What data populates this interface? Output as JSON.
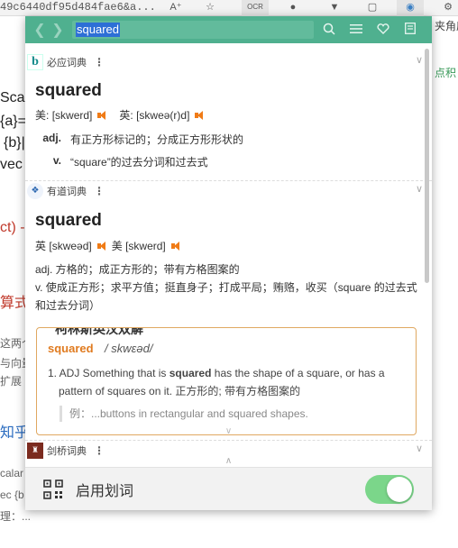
{
  "browser": {
    "url_fragment": "49c6440df95d484fae6&a...",
    "reader_icon": "A⁺",
    "extension_icons": [
      "bookmark-icon",
      "ocr-icon",
      "extension-icon",
      "extension-icon",
      "extension-icon",
      "extension-icon"
    ],
    "right_fragment_1": "夹角度",
    "right_fragment_2": "点积"
  },
  "background": {
    "lines": [
      "Scal",
      "{a}=",
      "{b}|",
      "vec",
      "ct) -",
      "算式",
      "这两个",
      "与向量",
      "扩展",
      "知乎",
      "calar",
      "ec {b",
      "理：..."
    ]
  },
  "popup": {
    "search_value": "squared",
    "accent": "#4fb08f",
    "header_buttons": [
      "search-icon",
      "menu-icon",
      "heart-icon",
      "bookmark-icon"
    ],
    "bing": {
      "name": "必应词典",
      "word": "squared",
      "phon_us_label": "美:",
      "phon_us": "[skwerd]",
      "phon_uk_label": "英:",
      "phon_uk": "[skweə(r)d]",
      "defs": [
        {
          "pos": "adj.",
          "text": "有正方形标记的；分成正方形形状的"
        },
        {
          "pos": "v.",
          "text": "“square”的过去分词和过去式"
        }
      ]
    },
    "youdao": {
      "name": "有道词典",
      "word": "squared",
      "phon_uk_label": "英",
      "phon_uk": "[skweəd]",
      "phon_us_label": "美",
      "phon_us": "[skwerd]",
      "def_adj": "adj. 方格的；成正方形的；带有方格图案的",
      "def_v": "v. 使成正方形；求平方值；挺直身子；打成平局；贿赂，收买（square 的过去式和过去分词）",
      "collins": {
        "title": "柯林斯英汉双解",
        "word": "squared",
        "phon": "/ skwεəd/",
        "def_prefix": "1. ADJ Something that is",
        "def_bold": "squared",
        "def_suffix": "has the shape of a square, or has a pattern of squares on it. 正方形的; 带有方格图案的",
        "example": "例：...buttons in rectangular and squared shapes."
      }
    },
    "cambridge": {
      "name": "剑桥词典"
    },
    "footer": {
      "label": "启用划词",
      "toggle_on": true,
      "toggle_color": "#7bd68a"
    }
  }
}
